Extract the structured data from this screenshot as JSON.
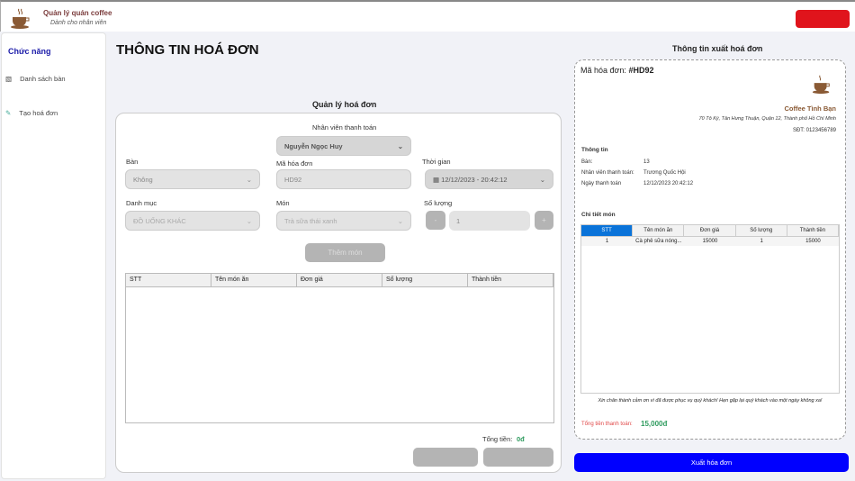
{
  "header": {
    "app_title": "Quản lý quán coffee",
    "app_subtitle": "Dành cho nhân viên"
  },
  "sidebar": {
    "heading": "Chức năng",
    "items": [
      {
        "label": "Danh sách bàn",
        "icon": "table-list-icon"
      },
      {
        "label": "Tạo hoá đơn",
        "icon": "edit-icon"
      }
    ]
  },
  "page_title": "THÔNG TIN HOÁ ĐƠN",
  "manage": {
    "title": "Quản lý hoá đơn",
    "employee_label": "Nhân viên thanh toán",
    "employee_value": "Nguyễn Ngọc Huy",
    "table_label": "Bàn",
    "table_value": "Không",
    "invoice_code_label": "Mã hóa đơn",
    "invoice_code_value": "HD92",
    "time_label": "Thời gian",
    "time_value": "12/12/2023 - 20:42:12",
    "category_label": "Danh mục",
    "category_value": "ĐỒ UỐNG KHÁC",
    "item_label": "Món",
    "item_value": "Trà sữa thái xanh",
    "qty_label": "Số lượng",
    "qty_value": "1",
    "minus": "-",
    "plus": "+",
    "add_button": "Thêm món",
    "columns": [
      "STT",
      "Tên món ăn",
      "Đơn giá",
      "Số lượng",
      "Thành tiền"
    ],
    "total_label": "Tổng tiền:",
    "total_value": "0đ"
  },
  "invoice": {
    "title": "Thông tin xuất hoá đơn",
    "code_label": "Mã hóa đơn:",
    "code_value": "#HD92",
    "shop_name": "Coffee Tình Bạn",
    "address": "70 Tô Ký, Tân Hưng Thuận, Quận 12, Thành phố Hồ Chí Minh",
    "phone": "SĐT: 0123456789",
    "info_heading": "Thông tin",
    "info": [
      {
        "label": "Bàn:",
        "value": "13"
      },
      {
        "label": "Nhân viên thanh toán:",
        "value": "Trương Quốc Hội"
      },
      {
        "label": "Ngày thanh toán",
        "value": "12/12/2023 20:42:12"
      }
    ],
    "detail_heading": "Chi tiết món",
    "columns": [
      "STT",
      "Tên món ăn",
      "Đơn giá",
      "Số lượng",
      "Thành tiền"
    ],
    "rows": [
      [
        "1",
        "Cà phê sữa nóng...",
        "15000",
        "1",
        "15000"
      ]
    ],
    "thanks": "Xin chân thành cảm ơn vì đã được phục vụ quý khách! Hẹn gặp lại quý khách vào một ngày không xa!",
    "total_label": "Tổng tiền thanh toán:",
    "total_value": "15,000đ"
  },
  "export_button": "Xuất hóa đơn",
  "colors": {
    "accent": "#0000ff",
    "brand": "#7a3b3b",
    "total": "#2e9b5e",
    "selected_header": "#0a73d9"
  }
}
